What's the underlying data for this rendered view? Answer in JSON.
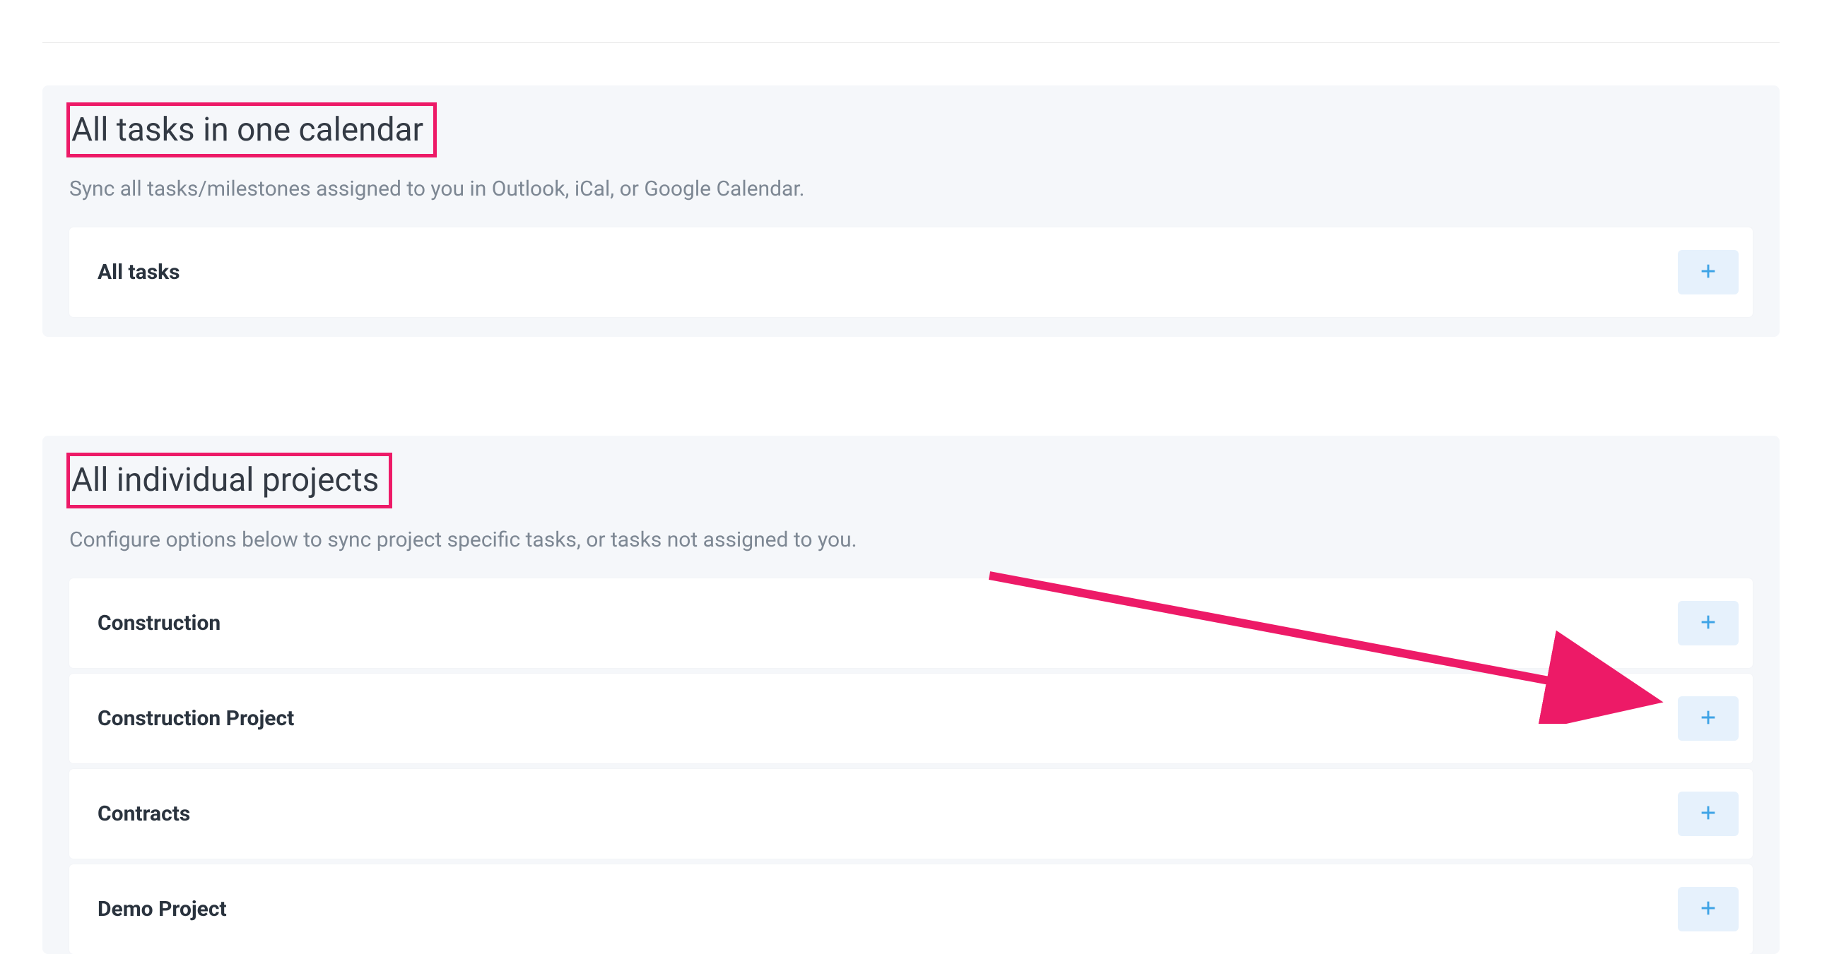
{
  "sections": [
    {
      "title": "All tasks in one calendar",
      "description": "Sync all tasks/milestones assigned to you in Outlook, iCal, or Google Calendar.",
      "items": [
        {
          "label": "All tasks"
        }
      ]
    },
    {
      "title": "All individual projects",
      "description": "Configure options below to sync project specific tasks, or tasks not assigned to you.",
      "items": [
        {
          "label": "Construction"
        },
        {
          "label": "Construction Project"
        },
        {
          "label": "Contracts"
        },
        {
          "label": "Demo Project"
        }
      ]
    }
  ],
  "annotation": {
    "highlight_color": "#ed1a67"
  }
}
